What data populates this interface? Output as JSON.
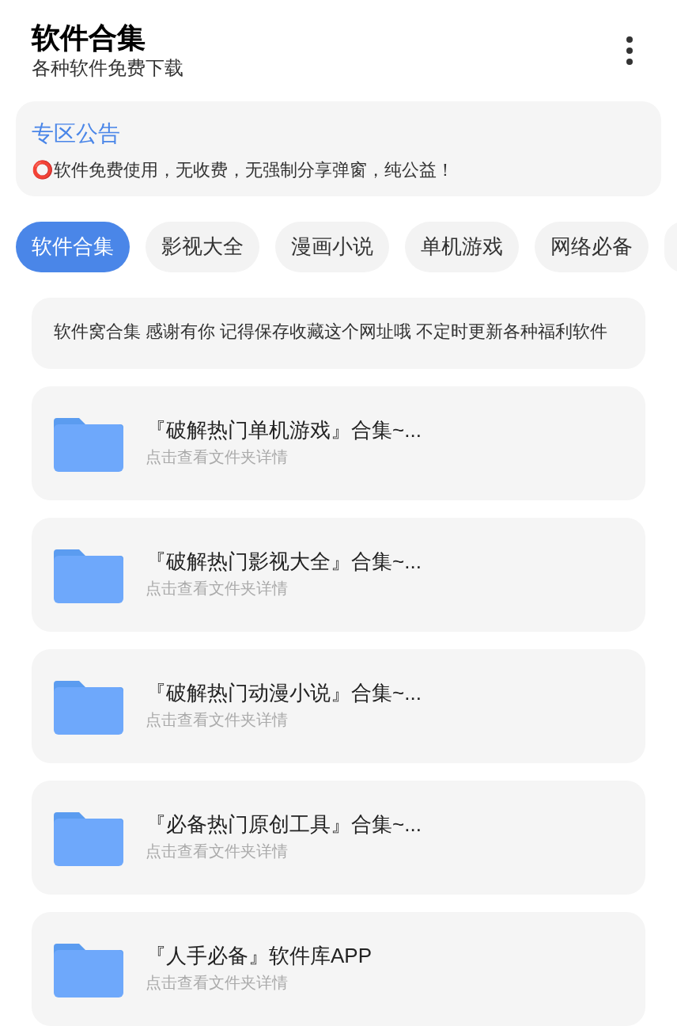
{
  "header": {
    "title": "软件合集",
    "subtitle": "各种软件免费下载"
  },
  "notice": {
    "title": "专区公告",
    "text": "⭕软件免费使用，无收费，无强制分享弹窗，纯公益！"
  },
  "tabs": [
    {
      "label": "软件合集",
      "selected": true
    },
    {
      "label": "影视大全",
      "selected": false
    },
    {
      "label": "漫画小说",
      "selected": false
    },
    {
      "label": "单机游戏",
      "selected": false
    },
    {
      "label": "网络必备",
      "selected": false
    }
  ],
  "marquee": "软件窝合集 感谢有你 记得保存收藏这个网址哦 不定时更新各种福利软件",
  "folders": [
    {
      "title": "『破解热门单机游戏』合集~...",
      "subtitle": "点击查看文件夹详情"
    },
    {
      "title": "『破解热门影视大全』合集~...",
      "subtitle": "点击查看文件夹详情"
    },
    {
      "title": "『破解热门动漫小说』合集~...",
      "subtitle": "点击查看文件夹详情"
    },
    {
      "title": "『必备热门原创工具』合集~...",
      "subtitle": "点击查看文件夹详情"
    },
    {
      "title": "『人手必备』软件库APP",
      "subtitle": "点击查看文件夹详情"
    }
  ]
}
